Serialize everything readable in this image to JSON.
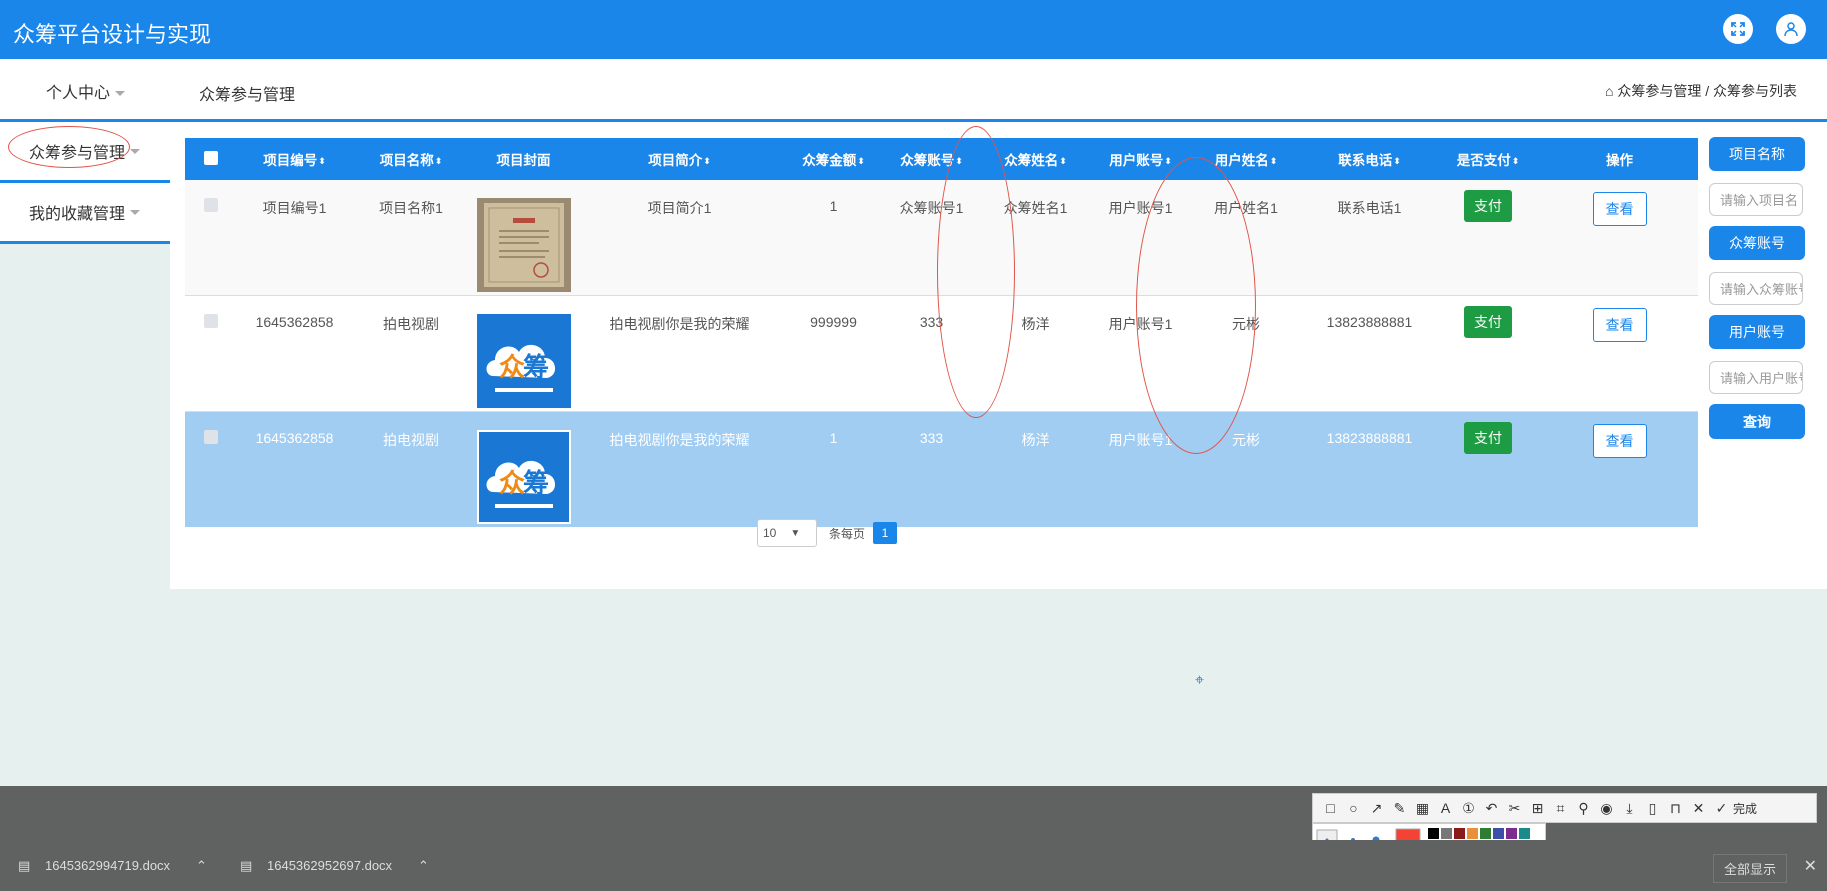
{
  "header": {
    "title": "众筹平台设计与实现"
  },
  "nav": {
    "personal": "个人中心",
    "section_title": "众筹参与管理",
    "breadcrumb": "众筹参与管理 / 众筹参与列表"
  },
  "sidebar": {
    "items": [
      {
        "label": "众筹参与管理"
      },
      {
        "label": "我的收藏管理"
      }
    ]
  },
  "table": {
    "headers": [
      "项目编号",
      "项目名称",
      "项目封面",
      "项目简介",
      "众筹金额",
      "众筹账号",
      "众筹姓名",
      "用户账号",
      "用户姓名",
      "联系电话",
      "是否支付",
      "操作"
    ],
    "rows": [
      {
        "code": "项目编号1",
        "name": "项目名称1",
        "intro": "项目简介1",
        "amount": "1",
        "fund_account": "众筹账号1",
        "fund_name": "众筹姓名1",
        "user_account": "用户账号1",
        "user_name": "用户姓名1",
        "phone": "联系电话1",
        "pay": "支付",
        "view": "查看"
      },
      {
        "code": "1645362858",
        "name": "拍电视剧",
        "intro": "拍电视剧你是我的荣耀",
        "amount": "999999",
        "fund_account": "333",
        "fund_name": "杨洋",
        "user_account": "用户账号1",
        "user_name": "元彬",
        "phone": "13823888881",
        "pay": "支付",
        "view": "查看"
      },
      {
        "code": "1645362858",
        "name": "拍电视剧",
        "intro": "拍电视剧你是我的荣耀",
        "amount": "1",
        "fund_account": "333",
        "fund_name": "杨洋",
        "user_account": "用户账号1",
        "user_name": "元彬",
        "phone": "13823888881",
        "pay": "支付",
        "view": "查看"
      }
    ]
  },
  "search": {
    "label1": "项目名称",
    "placeholder1": "请输入项目名",
    "label2": "众筹账号",
    "placeholder2": "请输入众筹账号",
    "label3": "用户账号",
    "placeholder3": "请输入用户账号",
    "button": "查询"
  },
  "pager": {
    "page_size": "10",
    "per_page_label": "条每页",
    "current_page": "1"
  },
  "toolbar": {
    "done": "完成"
  },
  "downloads": {
    "file1": "1645362994719.docx",
    "file2": "1645362952697.docx",
    "show_all": "全部显示"
  },
  "colors": {
    "primary": "#1b86ea",
    "pay_green": "#1e9c43",
    "annotation_red": "#e1544a"
  }
}
